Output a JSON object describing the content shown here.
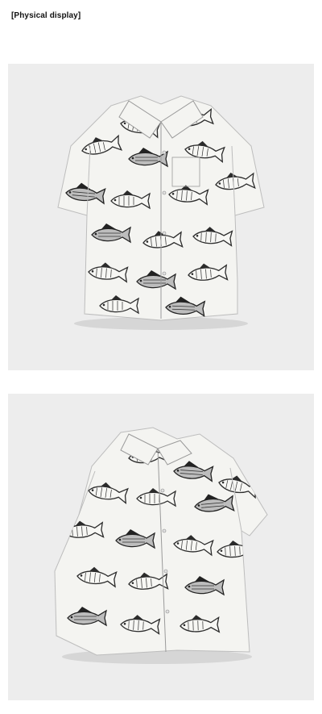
{
  "header": {
    "label": "[Physical display]"
  },
  "photos": [
    {
      "name": "shirt-photo-front",
      "background": "#ededed",
      "subject": "fish-print-shirt-front-icon"
    },
    {
      "name": "shirt-photo-angled",
      "background": "#ededed",
      "subject": "fish-print-shirt-angled-icon"
    }
  ],
  "colors": {
    "page_background": "#ffffff",
    "panel_background": "#ededed",
    "shirt_fabric": "#f4f4f1",
    "print_ink": "#2b2b2b"
  }
}
